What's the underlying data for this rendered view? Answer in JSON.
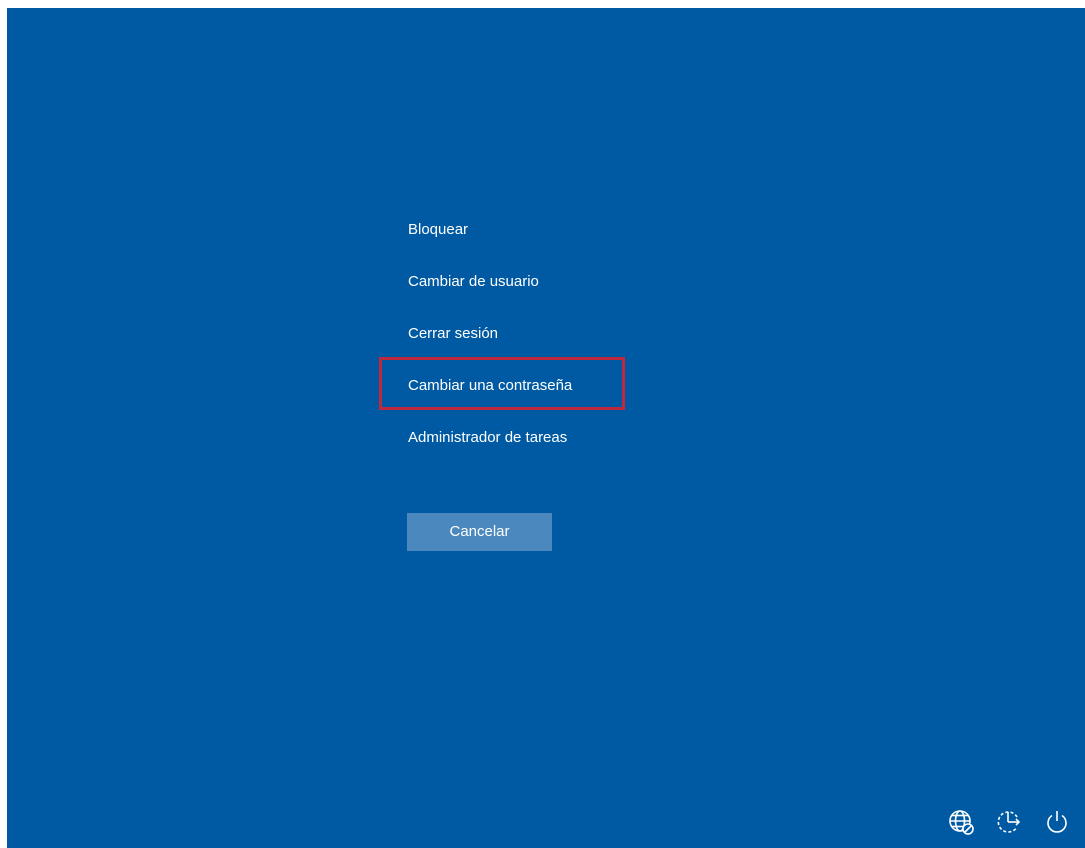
{
  "menu": {
    "items": [
      {
        "id": "lock",
        "label": "Bloquear"
      },
      {
        "id": "switch-user",
        "label": "Cambiar de usuario"
      },
      {
        "id": "sign-out",
        "label": "Cerrar sesión"
      },
      {
        "id": "change-password",
        "label": "Cambiar una contraseña",
        "highlighted": true
      },
      {
        "id": "task-manager",
        "label": "Administrador de tareas"
      }
    ]
  },
  "cancel": {
    "label": "Cancelar"
  },
  "tray": {
    "icons": [
      "network-icon",
      "accessibility-icon",
      "power-icon"
    ]
  },
  "colors": {
    "background": "#005aa3",
    "button": "#4a88bd",
    "highlight": "#c0283b",
    "text": "#ffffff"
  }
}
